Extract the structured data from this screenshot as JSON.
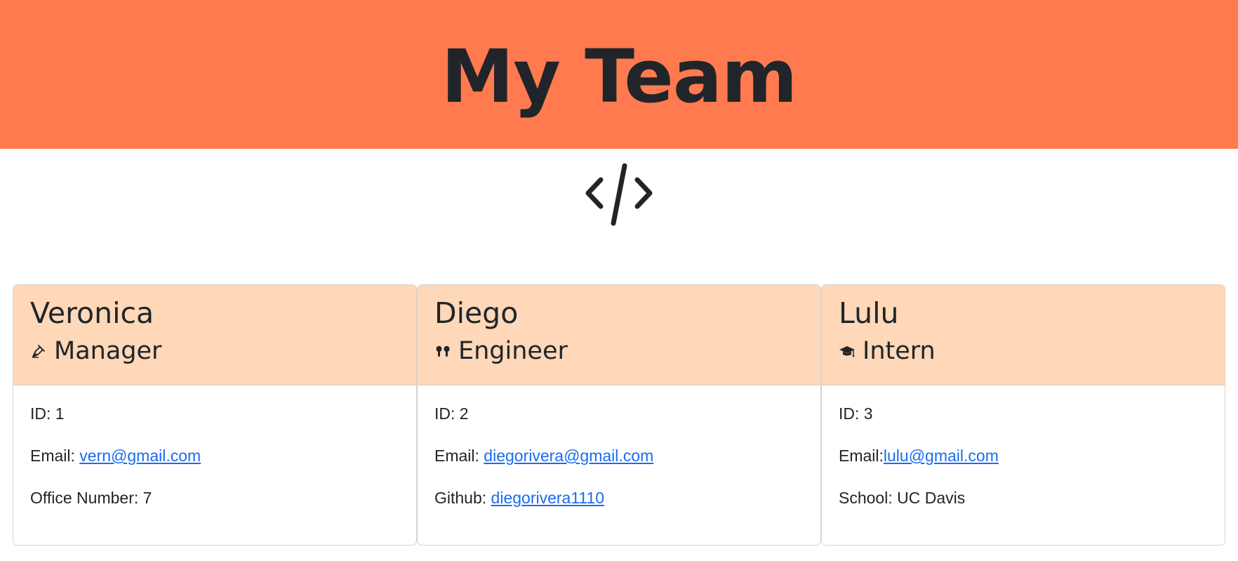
{
  "header": {
    "title": "My Team",
    "background_color": "#ff7b4f"
  },
  "logo": {
    "icon": "code-icon"
  },
  "team": [
    {
      "name": "Veronica",
      "role": "Manager",
      "role_icon": "pen-icon",
      "id_label": "ID: 1",
      "email_label": "Email: ",
      "email": "vern@gmail.com",
      "extra_label": "Office Number: 7",
      "extra_link": ""
    },
    {
      "name": "Diego",
      "role": "Engineer",
      "role_icon": "earbuds-icon",
      "id_label": "ID: 2",
      "email_label": "Email: ",
      "email": "diegorivera@gmail.com",
      "extra_label": "Github: ",
      "extra_link": "diegorivera1110"
    },
    {
      "name": "Lulu",
      "role": "Intern",
      "role_icon": "graduation-cap-icon",
      "id_label": "ID: 3",
      "email_label": "Email:",
      "email": "lulu@gmail.com",
      "extra_label": "School: UC Davis",
      "extra_link": ""
    }
  ],
  "colors": {
    "card_header": "#fed8b8",
    "link": "#1a6cf0",
    "text": "#212529"
  }
}
